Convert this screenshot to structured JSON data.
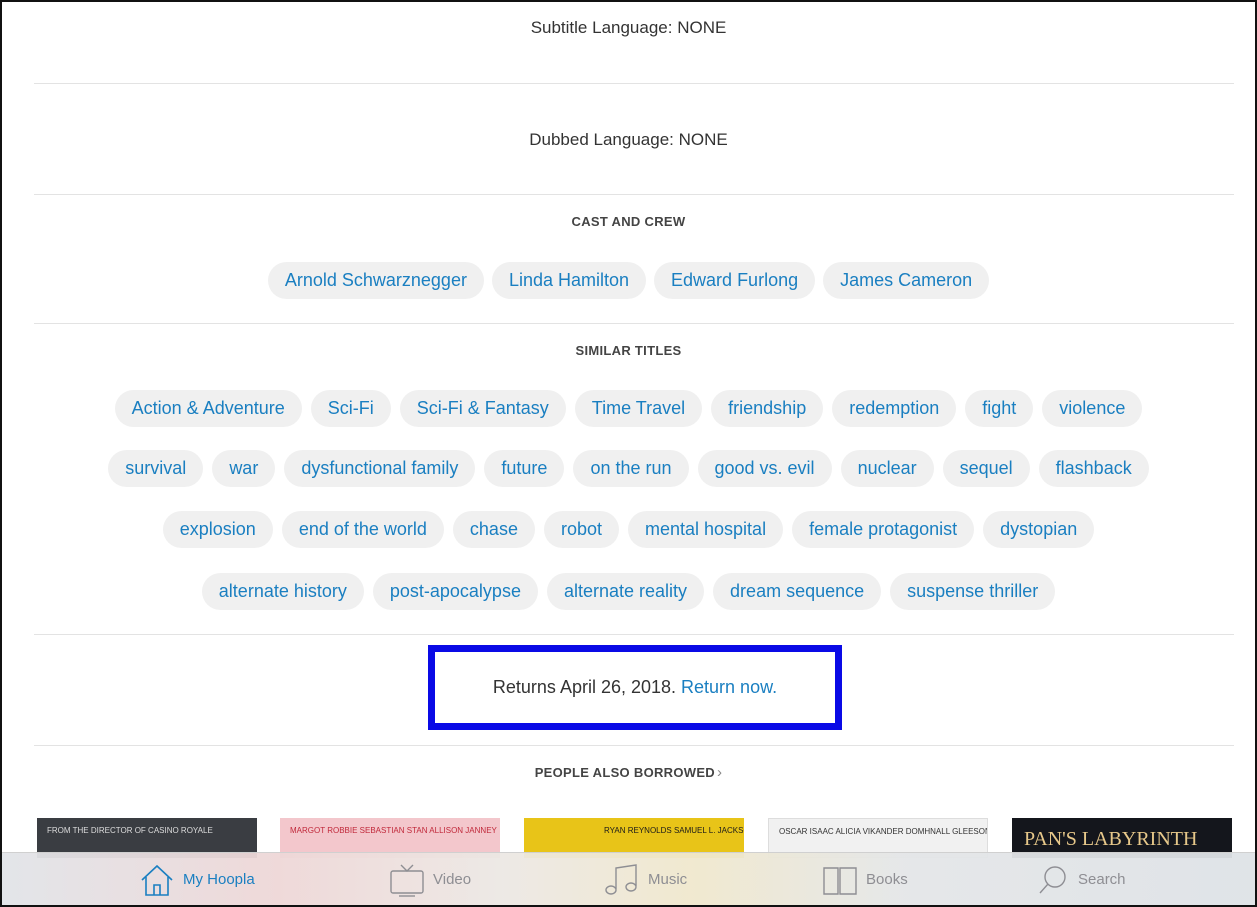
{
  "subtitle_language": "Subtitle Language: NONE",
  "dubbed_language": "Dubbed Language: NONE",
  "cast_and_crew": {
    "heading": "CAST AND CREW",
    "people": [
      "Arnold Schwarznegger",
      "Linda Hamilton",
      "Edward Furlong",
      "James Cameron"
    ]
  },
  "similar_titles": {
    "heading": "SIMILAR TITLES",
    "rows": [
      [
        "Action & Adventure",
        "Sci-Fi",
        "Sci-Fi & Fantasy",
        "Time Travel",
        "friendship",
        "redemption",
        "fight",
        "violence"
      ],
      [
        "survival",
        "war",
        "dysfunctional family",
        "future",
        "on the run",
        "good vs. evil",
        "nuclear",
        "sequel",
        "flashback"
      ],
      [
        "explosion",
        "end of the world",
        "chase",
        "robot",
        "mental hospital",
        "female protagonist",
        "dystopian"
      ],
      [
        "alternate history",
        "post-apocalypse",
        "alternate reality",
        "dream sequence",
        "suspense thriller"
      ]
    ]
  },
  "returns": {
    "text": "Returns April 26, 2018.",
    "link": "Return now.",
    "highlight_color": "#0a0ae6"
  },
  "people_also_borrowed": {
    "heading": "PEOPLE ALSO BORROWED",
    "posters": [
      {
        "caption": "FROM THE DIRECTOR OF CASINO ROYALE",
        "bg": "#3a3d42",
        "fg": "#dddddd"
      },
      {
        "caption": "MARGOT ROBBIE  SEBASTIAN STAN  ALLISON JANNEY",
        "bg": "#f3c7cc",
        "fg": "#c0283a"
      },
      {
        "caption": "RYAN REYNOLDS  SAMUEL L. JACKSON",
        "bg": "#e8c418",
        "fg": "#1a1a1a"
      },
      {
        "caption": "OSCAR ISAAC   ALICIA VIKANDER   DOMHNALL GLEESON",
        "bg": "#f1f1f1",
        "fg": "#333333"
      },
      {
        "caption": "PAN'S LABYRINTH",
        "bg": "#14161c",
        "fg": "#e7c88a"
      }
    ]
  },
  "tabbar": {
    "tabs": [
      {
        "label": "My Hoopla",
        "icon": "home-icon",
        "active": true
      },
      {
        "label": "Video",
        "icon": "tv-icon",
        "active": false
      },
      {
        "label": "Music",
        "icon": "music-note-icon",
        "active": false
      },
      {
        "label": "Books",
        "icon": "book-icon",
        "active": false
      },
      {
        "label": "Search",
        "icon": "search-icon",
        "active": false
      }
    ]
  },
  "colors": {
    "accent": "#1a7fc1",
    "chip_bg": "#f0f0f0"
  }
}
